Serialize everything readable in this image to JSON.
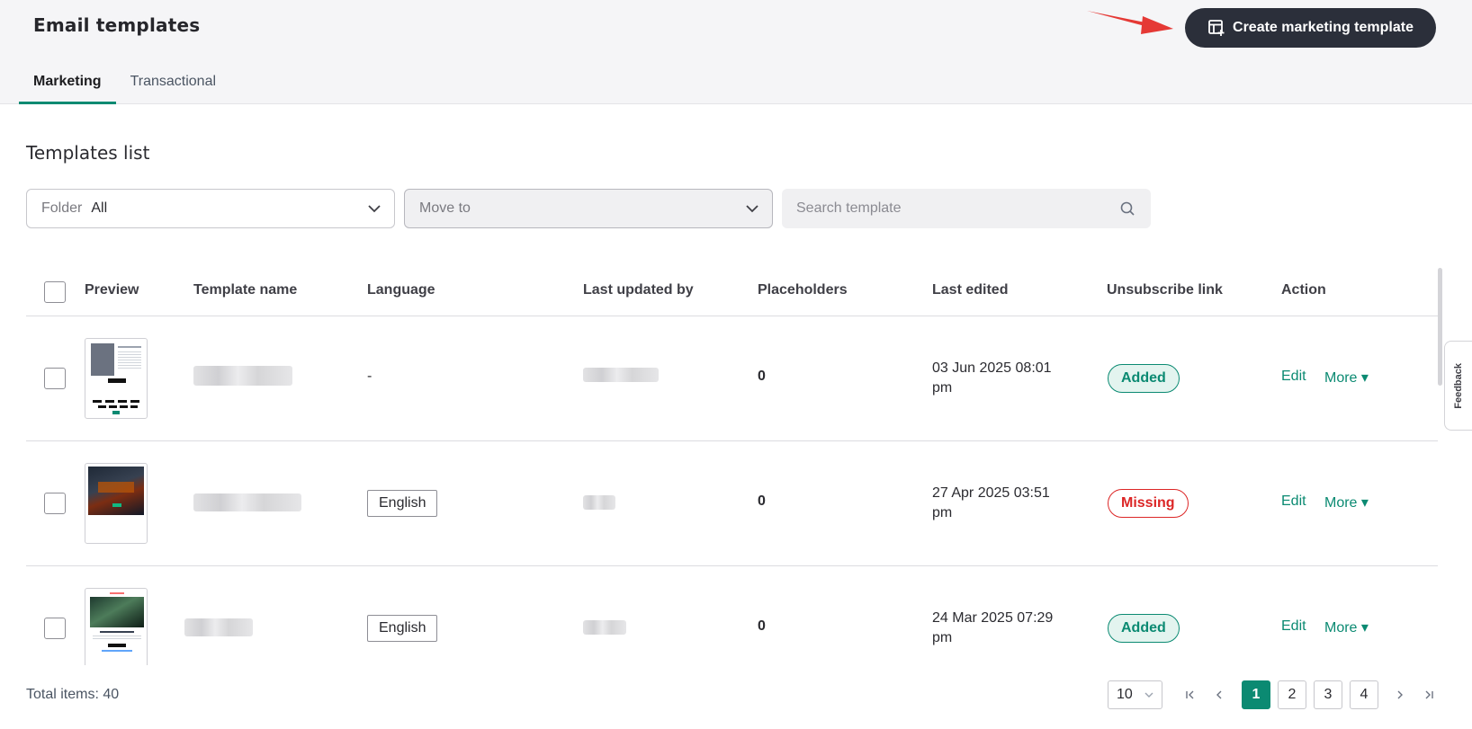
{
  "header": {
    "title": "Email templates",
    "create_button_label": "Create marketing template"
  },
  "tabs": [
    {
      "label": "Marketing",
      "active": true
    },
    {
      "label": "Transactional",
      "active": false
    }
  ],
  "section_title": "Templates list",
  "filters": {
    "folder_label": "Folder",
    "folder_value": "All",
    "move_to_placeholder": "Move to",
    "search_placeholder": "Search template"
  },
  "table": {
    "columns": [
      "Preview",
      "Template name",
      "Language",
      "Last updated by",
      "Placeholders",
      "Last edited",
      "Unsubscribe link",
      "Action"
    ],
    "rows": [
      {
        "language": "-",
        "placeholders": "0",
        "last_edited": "03 Jun 2025 08:01 pm",
        "unsubscribe": "Added",
        "edit_label": "Edit",
        "more_label": "More ▾"
      },
      {
        "language": "English",
        "placeholders": "0",
        "last_edited": "27 Apr 2025 03:51 pm",
        "unsubscribe": "Missing",
        "edit_label": "Edit",
        "more_label": "More ▾"
      },
      {
        "language": "English",
        "placeholders": "0",
        "last_edited": "24 Mar 2025 07:29 pm",
        "unsubscribe": "Added",
        "edit_label": "Edit",
        "more_label": "More ▾"
      }
    ]
  },
  "pagination": {
    "total": "Total items: 40",
    "page_size": "10",
    "pages": [
      "1",
      "2",
      "3",
      "4"
    ],
    "current_page": "1"
  },
  "feedback_label": "Feedback",
  "colors": {
    "accent": "#0b8a72",
    "danger": "#dc2626",
    "primary_button": "#2b2f3a",
    "annotation_arrow": "#e53935"
  }
}
